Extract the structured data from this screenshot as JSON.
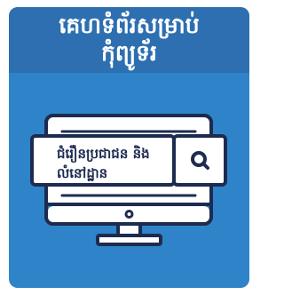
{
  "header": {
    "title_line1": "គេហទំព័រសម្រាប់",
    "title_line2": "កុំព្យូទ័រ"
  },
  "search_box": {
    "text_line1": "ជំរឿនប្រជាជន និង",
    "text_line2": "លំនៅដ្ឋាន"
  },
  "icons": {
    "search": "search-icon",
    "monitor": "monitor-icon",
    "power_button": "power-button-icon"
  },
  "colors": {
    "card_background": "#2f84c9",
    "header_background": "#2d6fb0",
    "line_art": "#1d2b4f",
    "text_light": "#ffffff"
  }
}
